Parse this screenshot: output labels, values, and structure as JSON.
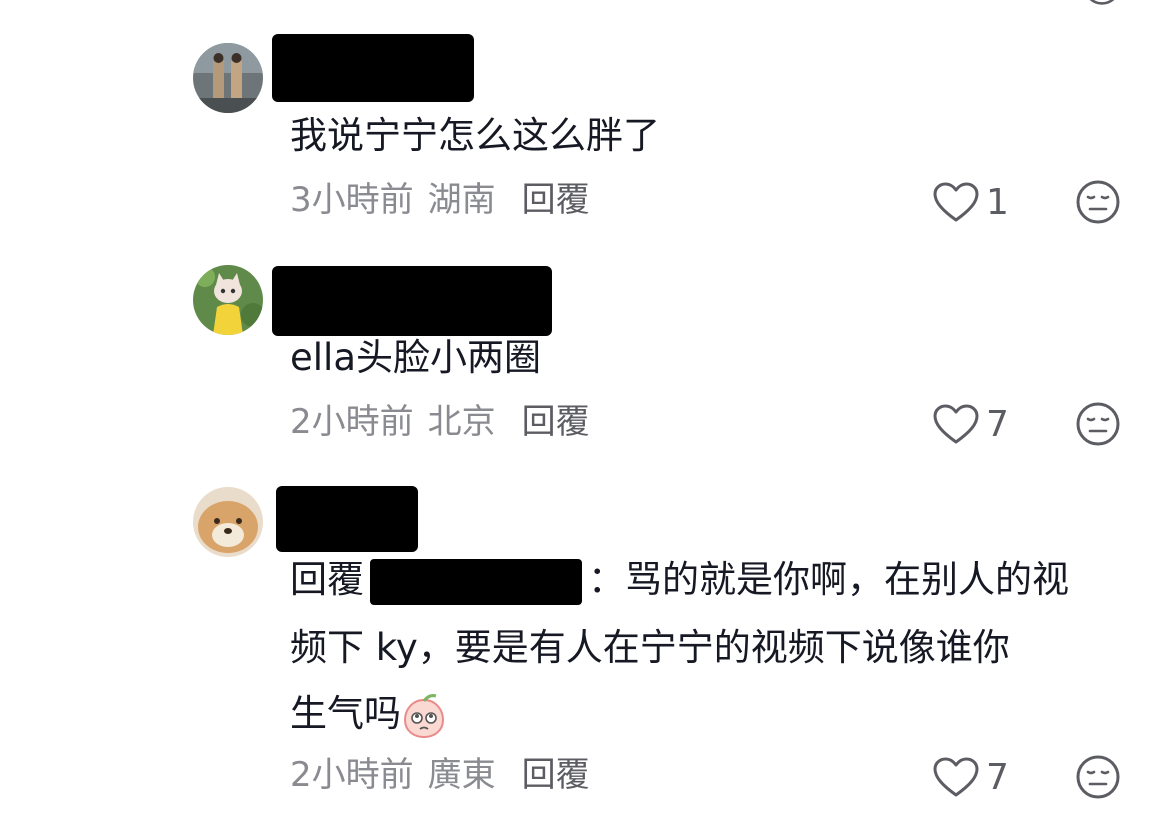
{
  "comments": [
    {
      "text": "我说宁宁怎么这么胖了",
      "time": "3小時前",
      "location": "湖南",
      "reply_label": "回覆",
      "likes": "1"
    },
    {
      "text": "ella头脸小两圈",
      "time": "2小時前",
      "location": "北京",
      "reply_label": "回覆",
      "likes": "7"
    },
    {
      "reply_prefix": "回覆",
      "colon": "：",
      "line1": "骂的就是你啊，在别人的视",
      "line2": "频下 ky，要是有人在宁宁的视频下说像谁你",
      "line3": "生气吗",
      "time": "2小時前",
      "location": "廣東",
      "reply_label": "回覆",
      "likes": "7"
    }
  ],
  "colors": {
    "text": "#161823",
    "meta": "#8a8b91",
    "reply": "#5c5d63",
    "redaction": "#000000"
  },
  "icons": [
    "heart-icon",
    "dislike-face-icon",
    "peach-emoji-icon"
  ]
}
